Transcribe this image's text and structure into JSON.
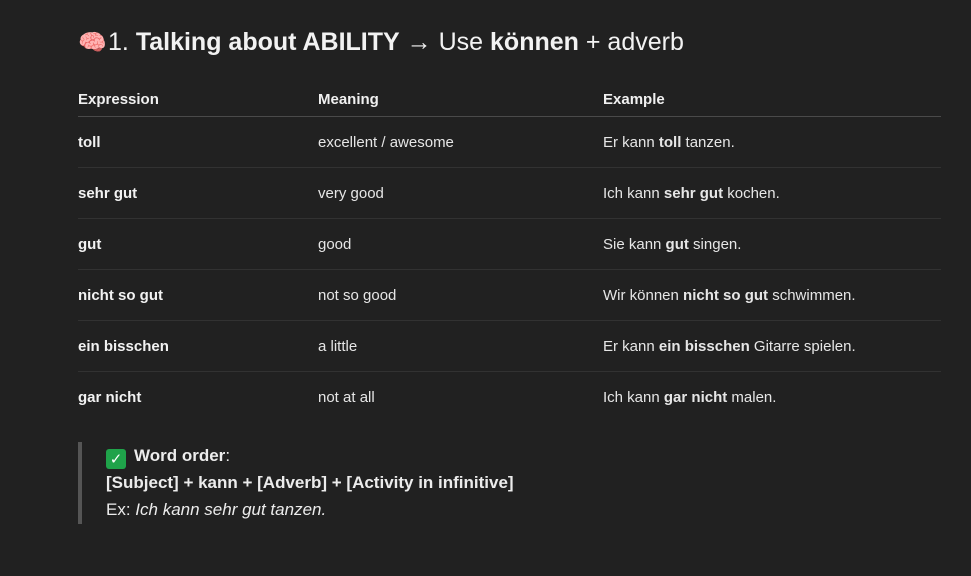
{
  "heading": {
    "icon": "brain-emoji",
    "emoji": "🧠",
    "number": "1.",
    "bold_part": "Talking about ABILITY",
    "arrow_use": "→ Use",
    "bold_verb": "können",
    "suffix": "+ adverb"
  },
  "table": {
    "headers": [
      "Expression",
      "Meaning",
      "Example"
    ],
    "rows": [
      {
        "expression": "toll",
        "meaning": "excellent / awesome",
        "ex_pre": "Er kann",
        "ex_bold": "toll",
        "ex_post": "tanzen."
      },
      {
        "expression": "sehr gut",
        "meaning": "very good",
        "ex_pre": "Ich kann",
        "ex_bold": "sehr gut",
        "ex_post": "kochen."
      },
      {
        "expression": "gut",
        "meaning": "good",
        "ex_pre": "Sie kann",
        "ex_bold": "gut",
        "ex_post": "singen."
      },
      {
        "expression": "nicht so gut",
        "meaning": "not so good",
        "ex_pre": "Wir können",
        "ex_bold": "nicht so gut",
        "ex_post": "schwimmen."
      },
      {
        "expression": "ein bisschen",
        "meaning": "a little",
        "ex_pre": "Er kann",
        "ex_bold": "ein bisschen",
        "ex_post": "Gitarre spielen."
      },
      {
        "expression": "gar nicht",
        "meaning": "not at all",
        "ex_pre": "Ich kann",
        "ex_bold": "gar nicht",
        "ex_post": "malen."
      }
    ]
  },
  "note": {
    "icon": "check-mark-icon",
    "check_glyph": "✓",
    "title": "Word order",
    "title_colon": ":",
    "formula": "[Subject] + kann + [Adverb] + [Activity in infinitive]",
    "example_prefix": "Ex:",
    "example_text": "Ich kann sehr gut tanzen."
  },
  "colors": {
    "background": "#212121",
    "check_green": "#1fa34a"
  }
}
